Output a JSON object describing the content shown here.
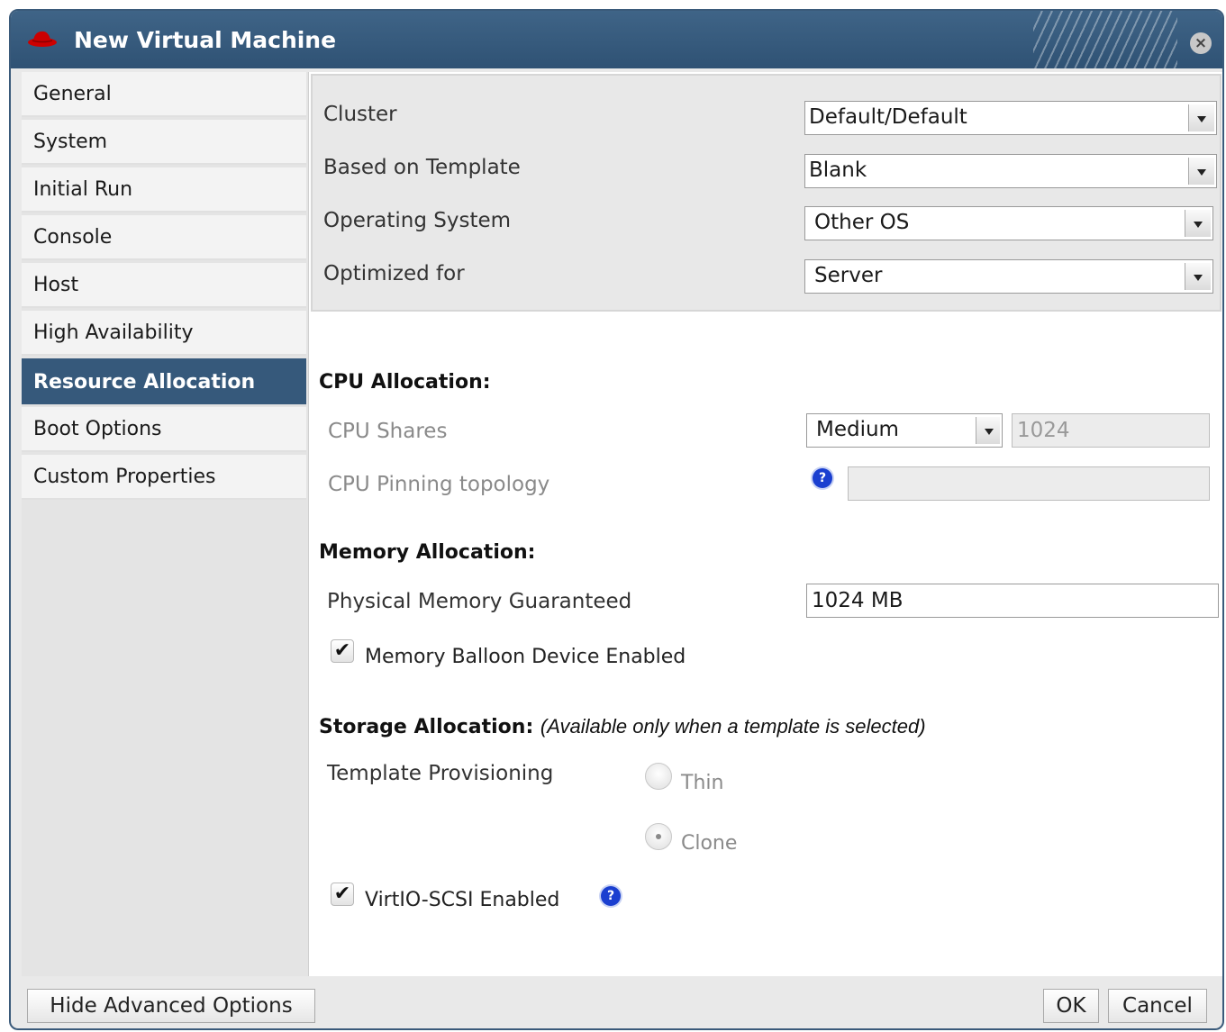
{
  "dialog": {
    "title": "New Virtual Machine"
  },
  "sidebar": {
    "items": [
      {
        "label": "General"
      },
      {
        "label": "System"
      },
      {
        "label": "Initial Run"
      },
      {
        "label": "Console"
      },
      {
        "label": "Host"
      },
      {
        "label": "High Availability"
      },
      {
        "label": "Resource Allocation",
        "active": true
      },
      {
        "label": "Boot Options"
      },
      {
        "label": "Custom Properties"
      }
    ]
  },
  "top": {
    "cluster": {
      "label": "Cluster",
      "value": "Default/Default"
    },
    "template": {
      "label": "Based on Template",
      "value": "Blank"
    },
    "os": {
      "label": "Operating System",
      "value": "Other OS"
    },
    "optimized": {
      "label": "Optimized for",
      "value": "Server"
    }
  },
  "cpu": {
    "heading": "CPU Allocation:",
    "shares_label": "CPU Shares",
    "shares_select": "Medium",
    "shares_value": "1024",
    "pinning_label": "CPU Pinning topology",
    "pinning_value": ""
  },
  "memory": {
    "heading": "Memory Allocation:",
    "guaranteed_label": "Physical Memory Guaranteed",
    "guaranteed_value": "1024 MB",
    "balloon_label": "Memory Balloon Device Enabled",
    "balloon_checked": true
  },
  "storage": {
    "heading": "Storage Allocation:",
    "note": "(Available only when a template is selected)",
    "provisioning_label": "Template Provisioning",
    "options": [
      {
        "label": "Thin",
        "checked": false
      },
      {
        "label": "Clone",
        "checked": true
      }
    ],
    "virtio_label": "VirtIO-SCSI Enabled",
    "virtio_checked": true
  },
  "footer": {
    "advanced_label": "Hide Advanced Options",
    "ok_label": "OK",
    "cancel_label": "Cancel"
  },
  "colors": {
    "title_bar": "#34587b",
    "active_tab": "#36597b",
    "help_icon": "#1a3fd0"
  }
}
